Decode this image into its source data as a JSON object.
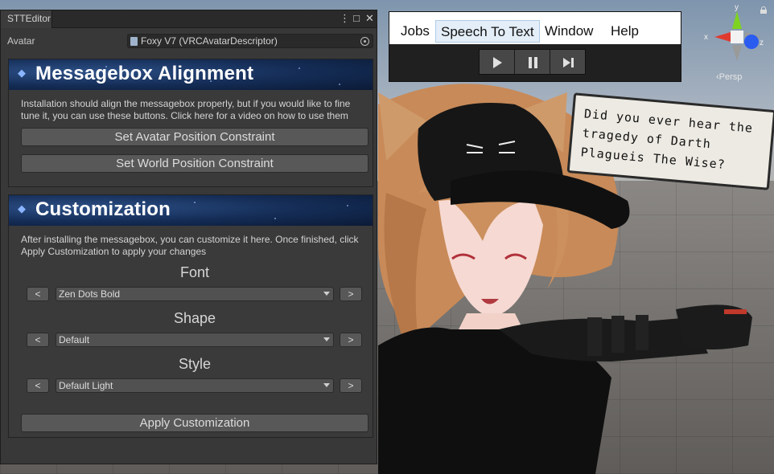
{
  "editor": {
    "tab_title": "STTEditor",
    "avatar_label": "Avatar",
    "avatar_value": "Foxy V7 (VRCAvatarDescriptor)"
  },
  "alignment": {
    "title": "Messagebox Alignment",
    "description": "Installation should align the messagebox properly, but if you would like to fine tune it, you can use these buttons. Click here for a video on how to use them",
    "avatar_constraint_button": "Set Avatar Position Constraint",
    "world_constraint_button": "Set World Position Constraint"
  },
  "customization": {
    "title": "Customization",
    "description": "After installing the messagebox, you can customize it here. Once finished, click Apply Customization to apply your changes",
    "prev_label": "<",
    "next_label": ">",
    "font_label": "Font",
    "font_value": "Zen Dots Bold",
    "shape_label": "Shape",
    "shape_value": "Default",
    "style_label": "Style",
    "style_value": "Default Light",
    "apply_button": "Apply Customization"
  },
  "menu": {
    "jobs": "Jobs",
    "speech_to_text": "Speech To Text",
    "window": "Window",
    "help": "Help"
  },
  "bubble": {
    "text": "Did you ever hear the tragedy of Darth Plagueis The Wise?"
  },
  "gizmo": {
    "x_label": "x",
    "y_label": "y",
    "z_label": "z",
    "persp_label": "Persp"
  },
  "colors": {
    "accent_blue": "#2c4f86",
    "panel_bg": "#383838",
    "button_bg": "#585858"
  }
}
